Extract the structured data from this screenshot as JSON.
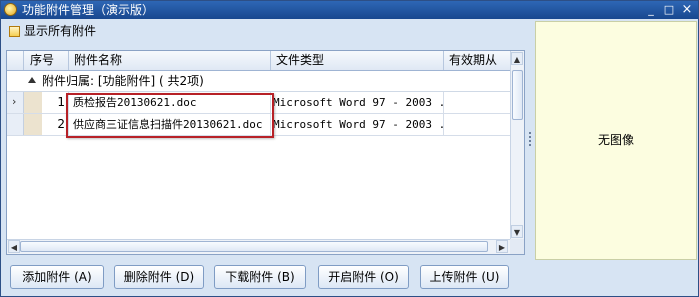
{
  "window": {
    "title": "功能附件管理（演示版）",
    "controls": {
      "minimize": "_",
      "maximize": "□",
      "close": "×"
    }
  },
  "options": {
    "show_all_label": "显示所有附件",
    "show_all_checked": false
  },
  "grid": {
    "columns": [
      "序号",
      "附件名称",
      "文件类型",
      "有效期从"
    ],
    "group_label": "附件归属: [功能附件] ( 共2项)",
    "rows": [
      {
        "index": "1",
        "name": "质检报告20130621.doc",
        "type": "Microsoft Word 97 - 2003 ...",
        "valid_from": "",
        "current": true
      },
      {
        "index": "2",
        "name": "供应商三证信息扫描件20130621.doc",
        "type": "Microsoft Word 97 - 2003 ...",
        "valid_from": "",
        "current": false
      }
    ]
  },
  "preview": {
    "placeholder": "无图像"
  },
  "buttons": {
    "add": "添加附件 (A)",
    "delete": "删除附件 (D)",
    "download": "下载附件 (B)",
    "open": "开启附件 (O)",
    "upload": "上传附件 (U)"
  },
  "icons": {
    "app": "app-magnifier-icon",
    "current_row": "row-pointer-icon",
    "group_toggle": "collapse-triangle-icon"
  },
  "colors": {
    "titlebar": "#1d4f9a",
    "highlight_box": "#b72127",
    "preview_bg": "#fcfde0",
    "window_bg": "#d7e4f3"
  }
}
